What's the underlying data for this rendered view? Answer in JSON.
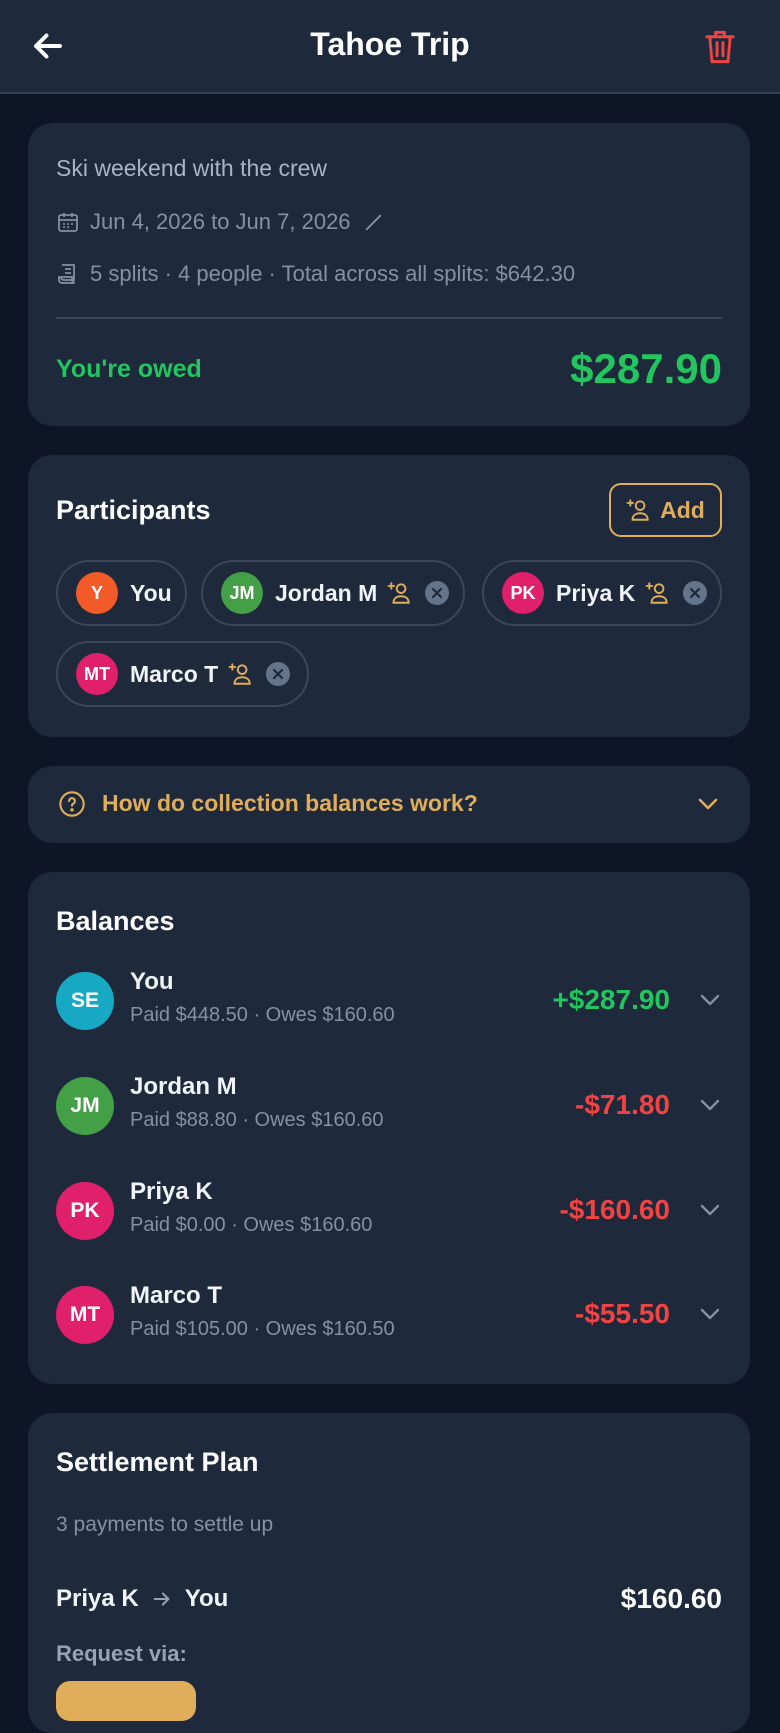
{
  "header": {
    "title": "Tahoe Trip"
  },
  "summary": {
    "description": "Ski weekend with the crew",
    "date_range": "Jun 4, 2026 to Jun 7, 2026",
    "stats": "5 splits · 4 people · Total across all splits: $642.30",
    "owed_label": "You're owed",
    "owed_amount": "$287.90"
  },
  "participants": {
    "title": "Participants",
    "add_label": "Add",
    "items": [
      {
        "initials": "Y",
        "name": "You",
        "color": "#f25a28"
      },
      {
        "initials": "JM",
        "name": "Jordan M",
        "color": "#43a047"
      },
      {
        "initials": "PK",
        "name": "Priya K",
        "color": "#e0206a"
      },
      {
        "initials": "MT",
        "name": "Marco T",
        "color": "#e0206a"
      }
    ]
  },
  "help": {
    "label": "How do collection balances work?"
  },
  "balances": {
    "title": "Balances",
    "items": [
      {
        "initials": "SE",
        "name": "You",
        "sub": "Paid $448.50 · Owes $160.60",
        "amount": "+$287.90",
        "color": "#17a9c4"
      },
      {
        "initials": "JM",
        "name": "Jordan M",
        "sub": "Paid $88.80 · Owes $160.60",
        "amount": "-$71.80",
        "color": "#43a047"
      },
      {
        "initials": "PK",
        "name": "Priya K",
        "sub": "Paid $0.00 · Owes $160.60",
        "amount": "-$160.60",
        "color": "#e0206a"
      },
      {
        "initials": "MT",
        "name": "Marco T",
        "sub": "Paid $105.00 · Owes $160.50",
        "amount": "-$55.50",
        "color": "#e0206a"
      }
    ]
  },
  "settlement": {
    "title": "Settlement Plan",
    "subtitle": "3 payments to settle up",
    "payments": [
      {
        "from": "Priya K",
        "to": "You",
        "amount": "$160.60"
      }
    ],
    "request_via": "Request via:"
  },
  "colors": {
    "accent": "#e0ad5a",
    "positive": "#22c55e",
    "negative": "#ef4444",
    "card": "#1e293b",
    "background": "#0d1526"
  }
}
